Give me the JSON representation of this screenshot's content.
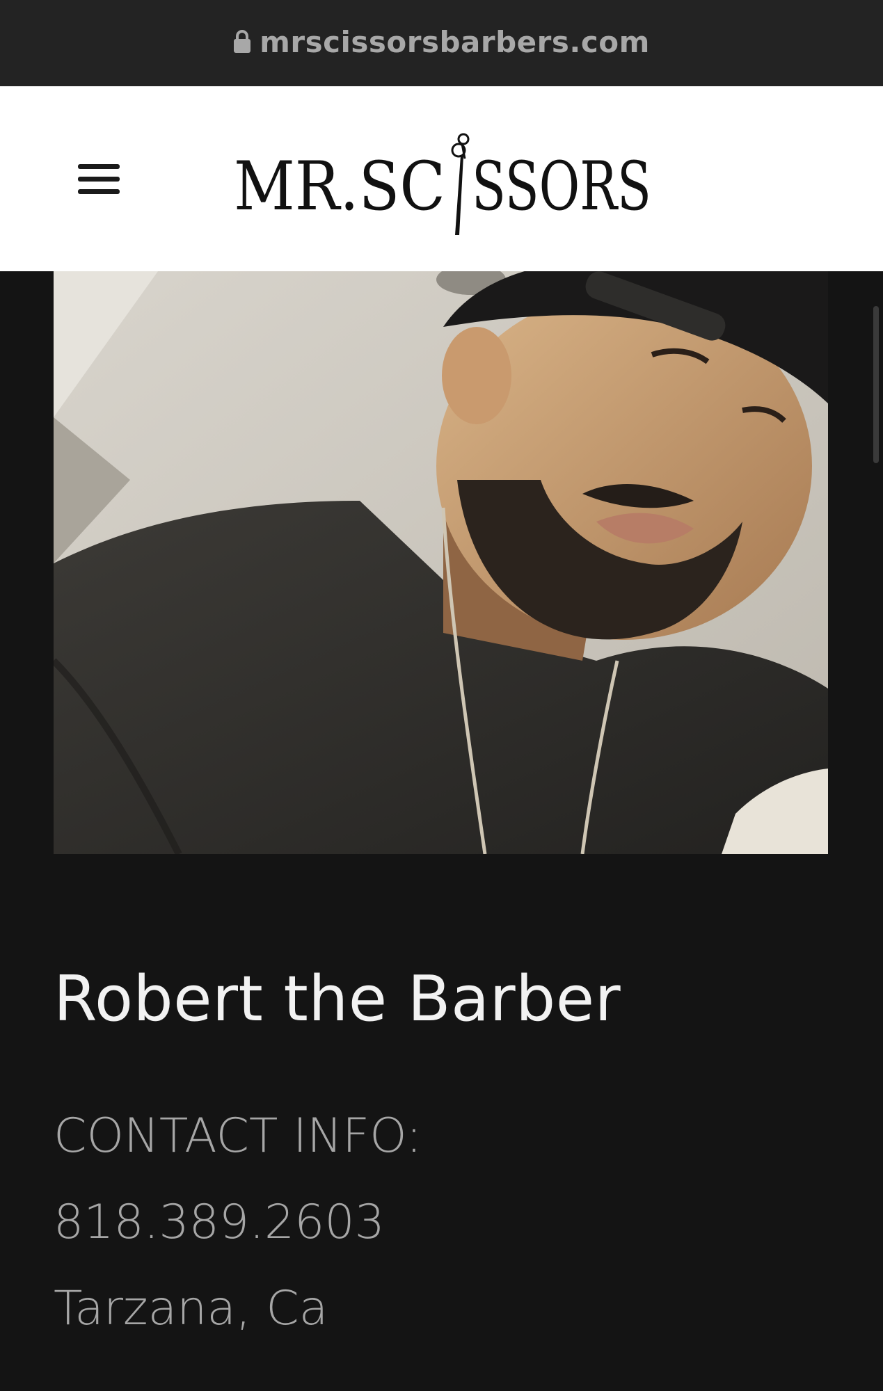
{
  "browser": {
    "url": "mrscissorsbarbers.com",
    "lock_icon": "lock-icon"
  },
  "header": {
    "menu_icon": "hamburger-menu-icon",
    "logo_text_left": "MR.SC",
    "logo_text_right": "SSORS",
    "logo_icon": "scissors-icon"
  },
  "profile": {
    "photo": "barber-portrait-photo",
    "name": "Robert the Barber",
    "contact_heading": "CONTACT INFO:",
    "phone": "818.389.2603",
    "location": "Tarzana, Ca"
  },
  "colors": {
    "page_background": "#141414",
    "urlbar_background": "#232323",
    "header_background": "#ffffff",
    "name_text": "#f2f2f2",
    "info_text": "#a6a6a6"
  }
}
